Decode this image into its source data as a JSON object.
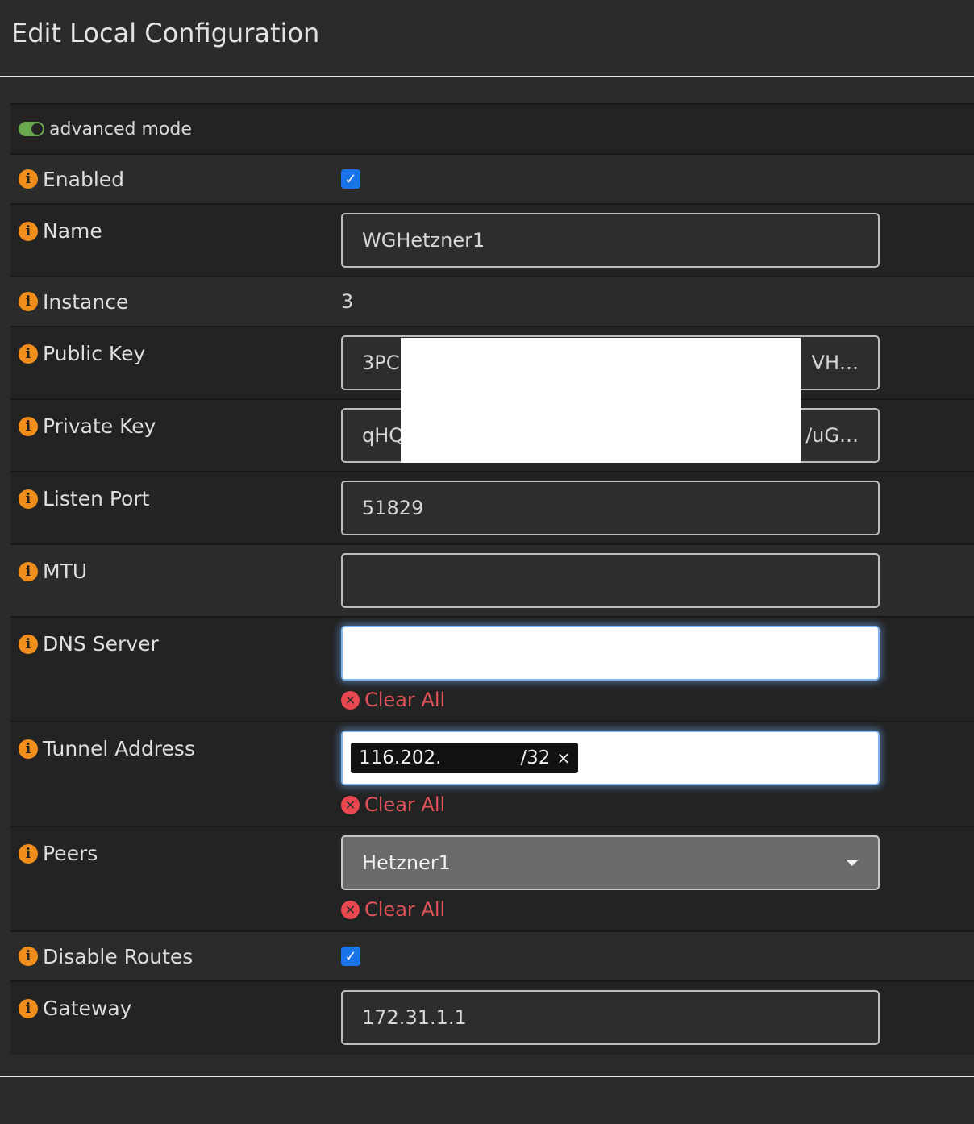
{
  "page": {
    "title": "Edit Local Configuration"
  },
  "advanced_mode": {
    "label": "advanced mode"
  },
  "fields": {
    "enabled": {
      "label": "Enabled",
      "checked": true
    },
    "name": {
      "label": "Name",
      "value": "WGHetzner1"
    },
    "instance": {
      "label": "Instance",
      "value": "3"
    },
    "public_key": {
      "label": "Public Key",
      "value_start": "3PC",
      "value_end": "VH…"
    },
    "private_key": {
      "label": "Private Key",
      "value_start": "qHQ",
      "value_end": "/uG…"
    },
    "listen_port": {
      "label": "Listen Port",
      "value": "51829"
    },
    "mtu": {
      "label": "MTU",
      "value": ""
    },
    "dns_server": {
      "label": "DNS Server",
      "value": "",
      "clear_label": "Clear All"
    },
    "tunnel_address": {
      "label": "Tunnel Address",
      "tag_start": "116.202.",
      "tag_end": "/32",
      "tag_remove": "×",
      "clear_label": "Clear All"
    },
    "peers": {
      "label": "Peers",
      "selected": "Hetzner1",
      "clear_label": "Clear All"
    },
    "disable_routes": {
      "label": "Disable Routes",
      "checked": true
    },
    "gateway": {
      "label": "Gateway",
      "value": "172.31.1.1"
    }
  },
  "icons": {
    "info": "info-icon",
    "clear": "clear-icon",
    "check": "✓"
  },
  "colors": {
    "info_orange": "#f08d1b",
    "clear_red": "#e0535a",
    "checkbox_blue": "#1a73e8",
    "toggle_green": "#6aa84f"
  }
}
